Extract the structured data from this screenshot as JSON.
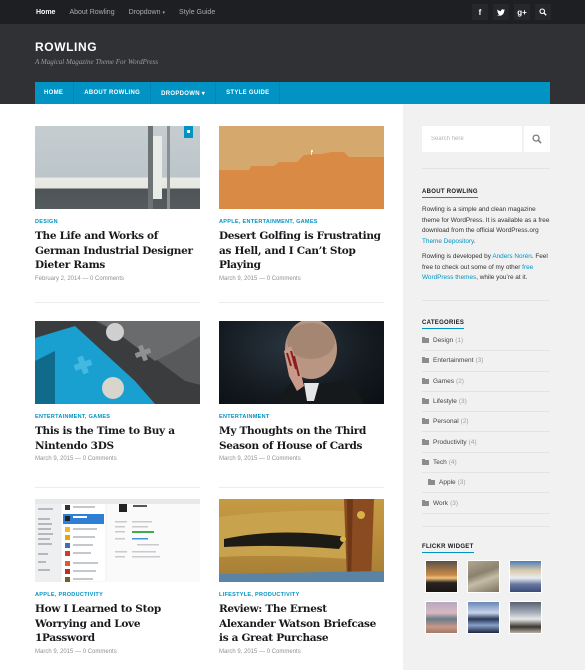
{
  "topbar": {
    "nav": [
      {
        "label": "Home",
        "active": true
      },
      {
        "label": "About Rowling",
        "active": false
      },
      {
        "label": "Dropdown",
        "active": false,
        "has_caret": true
      },
      {
        "label": "Style Guide",
        "active": false
      }
    ],
    "social": [
      {
        "icon": "facebook-icon",
        "glyph": "f"
      },
      {
        "icon": "twitter-icon",
        "glyph": "t"
      },
      {
        "icon": "google-plus-icon",
        "glyph": "g+"
      },
      {
        "icon": "search-icon",
        "glyph": "⌕"
      }
    ]
  },
  "header": {
    "title": "ROWLING",
    "tagline": "A Magical Magazine Theme For WordPress"
  },
  "mainnav": {
    "items": [
      "HOME",
      "ABOUT ROWLING",
      "DROPDOWN ▾",
      "STYLE GUIDE"
    ]
  },
  "posts": [
    {
      "categories": "DESIGN",
      "title": "The Life and Works of German Industrial Designer Dieter Rams",
      "meta": "February 2, 2014 — 0 Comments",
      "sticky": true
    },
    {
      "categories": "APPLE, ENTERTAINMENT, GAMES",
      "title": "Desert Golfing is Frustrating as Hell, and I Can’t Stop Playing",
      "meta": "March 9, 2015 — 0 Comments"
    },
    {
      "categories": "ENTERTAINMENT, GAMES",
      "title": "This is the Time to Buy a Nintendo 3DS",
      "meta": "March 9, 2015 — 0 Comments"
    },
    {
      "categories": "ENTERTAINMENT",
      "title": "My Thoughts on the Third Season of House of Cards",
      "meta": "March 9, 2015 — 0 Comments"
    },
    {
      "categories": "APPLE, PRODUCTIVITY",
      "title": "How I Learned to Stop Worrying and Love 1Password",
      "meta": "March 9, 2015 — 0 Comments"
    },
    {
      "categories": "LIFESTYLE, PRODUCTIVITY",
      "title": "Review: The Ernest Alexander Watson Briefcase is a Great Purchase",
      "meta": "March 9, 2015 — 0 Comments"
    }
  ],
  "sidebar": {
    "search": {
      "placeholder": "Search here"
    },
    "about": {
      "title": "ABOUT ROWLING",
      "p1_text": "Rowling is a simple and clean magazine theme for WordPress. It is available as a free download from the official WordPress.org ",
      "p1_link": "Theme Depository",
      "p1_end": ".",
      "p2_text": "Rowling is developed by ",
      "p2_link1": "Anders Norén",
      "p2_mid": ". Feel free to check out some of my other ",
      "p2_link2": "free WordPress themes",
      "p2_end": ", while you’re at it."
    },
    "categories": {
      "title": "CATEGORIES",
      "items": [
        {
          "name": "Design",
          "count": "(1)"
        },
        {
          "name": "Entertainment",
          "count": "(3)"
        },
        {
          "name": "Games",
          "count": "(2)"
        },
        {
          "name": "Lifestyle",
          "count": "(3)"
        },
        {
          "name": "Personal",
          "count": "(2)"
        },
        {
          "name": "Productivity",
          "count": "(4)"
        },
        {
          "name": "Tech",
          "count": "(4)"
        },
        {
          "name": "Apple",
          "count": "(3)",
          "child": true
        },
        {
          "name": "Work",
          "count": "(3)"
        }
      ]
    },
    "flickr": {
      "title": "FLICKR WIDGET"
    }
  },
  "colors": {
    "accent": "#0093c4",
    "topbar": "#1d1f22",
    "header": "#2f3135",
    "sidebar_bg": "#f1f1f1"
  }
}
